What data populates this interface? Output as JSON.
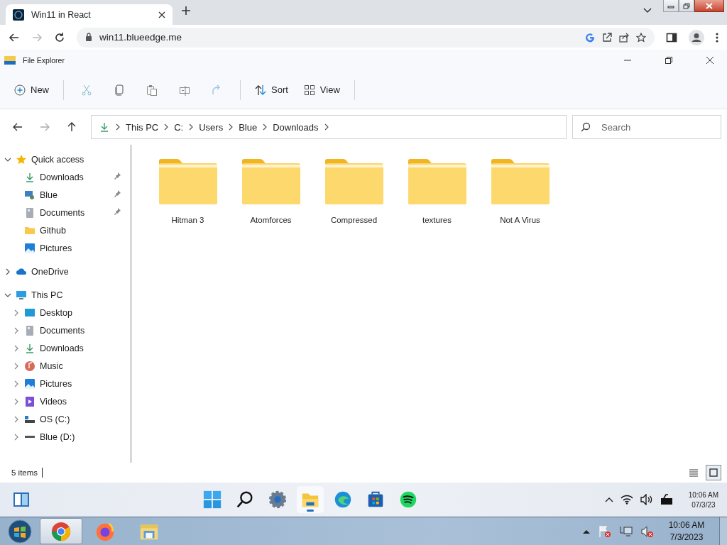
{
  "browser": {
    "tabs": [
      {
        "title": "Win11 in React",
        "selected": true
      }
    ],
    "url": "win11.blueedge.me"
  },
  "window": {
    "title": "File Explorer"
  },
  "toolbar": {
    "new": "New",
    "sort": "Sort",
    "view": "View"
  },
  "address": {
    "path": [
      "This PC",
      "C:",
      "Users",
      "Blue",
      "Downloads"
    ]
  },
  "search": {
    "placeholder": "Search"
  },
  "sidebar": {
    "sections": [
      {
        "label": "Quick access",
        "expanded": true,
        "children": [
          {
            "label": "Downloads",
            "pinned": true
          },
          {
            "label": "Blue",
            "pinned": true
          },
          {
            "label": "Documents",
            "pinned": true
          },
          {
            "label": "Github",
            "pinned": false
          },
          {
            "label": "Pictures",
            "pinned": false
          }
        ]
      },
      {
        "label": "OneDrive",
        "expanded": false
      },
      {
        "label": "This PC",
        "expanded": true,
        "children": [
          {
            "label": "Desktop",
            "expanded": false
          },
          {
            "label": "Documents",
            "expanded": false
          },
          {
            "label": "Downloads",
            "expanded": false
          },
          {
            "label": "Music",
            "expanded": false
          },
          {
            "label": "Pictures",
            "expanded": false
          },
          {
            "label": "Videos",
            "expanded": false
          },
          {
            "label": "OS (C:)",
            "expanded": false
          },
          {
            "label": "Blue (D:)",
            "expanded": false
          }
        ]
      }
    ]
  },
  "files": [
    {
      "name": "Hitman 3"
    },
    {
      "name": "Atomforces"
    },
    {
      "name": "Compressed"
    },
    {
      "name": "textures"
    },
    {
      "name": "Not A Virus"
    }
  ],
  "status_bar": {
    "count": "5 items",
    "view_modes": [
      {
        "selected": false
      },
      {
        "selected": true
      }
    ]
  },
  "taskbar": {
    "apps": [
      {
        "selected": false
      },
      {
        "selected": false
      },
      {
        "selected": false
      },
      {
        "selected": true
      },
      {
        "selected": false
      },
      {
        "selected": false
      },
      {
        "selected": false
      }
    ],
    "time": "10:06 AM",
    "date": "07/3/23"
  },
  "host_taskbar": {
    "apps": [
      {
        "selected": true
      },
      {
        "selected": false
      },
      {
        "selected": false
      }
    ],
    "time": "10:06 AM",
    "date": "7/3/2023"
  }
}
